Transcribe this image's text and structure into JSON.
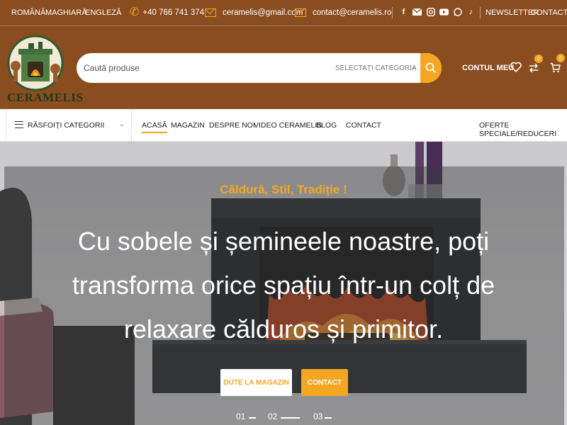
{
  "topbar": {
    "languages": [
      "ROMÂNĂ",
      "MAGHIARĂ",
      "ENGLEZĂ"
    ],
    "phone": "+40 766 741 374",
    "email1": "ceramelis@gmail.com",
    "email2": "contact@ceramelis.ro",
    "social_icons": [
      "facebook-icon",
      "email-icon",
      "instagram-icon",
      "youtube-icon",
      "whatsapp-icon",
      "tiktok-icon"
    ],
    "newsletter": "NEWSLETTER",
    "contact": "CONTACT"
  },
  "header": {
    "logo_text": "CERAMELIS",
    "search": {
      "placeholder": "Caută produse",
      "category": "SELECTAȚI CATEGORIA"
    },
    "account": "CONTUL MEU",
    "compare_count": "0",
    "cart_count": "0"
  },
  "nav": {
    "browse": "RĂSFOIȚI CATEGORII",
    "items": [
      "ACASĂ",
      "MAGAZIN",
      "DESPRE NOI",
      "VIDEO CERAMELIS",
      "BLOG",
      "CONTACT"
    ],
    "right": "OFERTE SPECIALE/REDUCERI"
  },
  "hero": {
    "tagline": "Căldură, Stil, Tradiție !",
    "lines": [
      "Cu sobele și șemineele noastre, poți",
      "transforma orice spațiu într-un colț de",
      "relaxare călduros și primitor."
    ],
    "button_shop": "DUTE LA MAGAZIN",
    "button_contact": "CONTACT",
    "slides": [
      "01",
      "02",
      "03"
    ]
  },
  "colors": {
    "brand_brown": "#8a4d1f",
    "accent_orange": "#f5a623"
  }
}
